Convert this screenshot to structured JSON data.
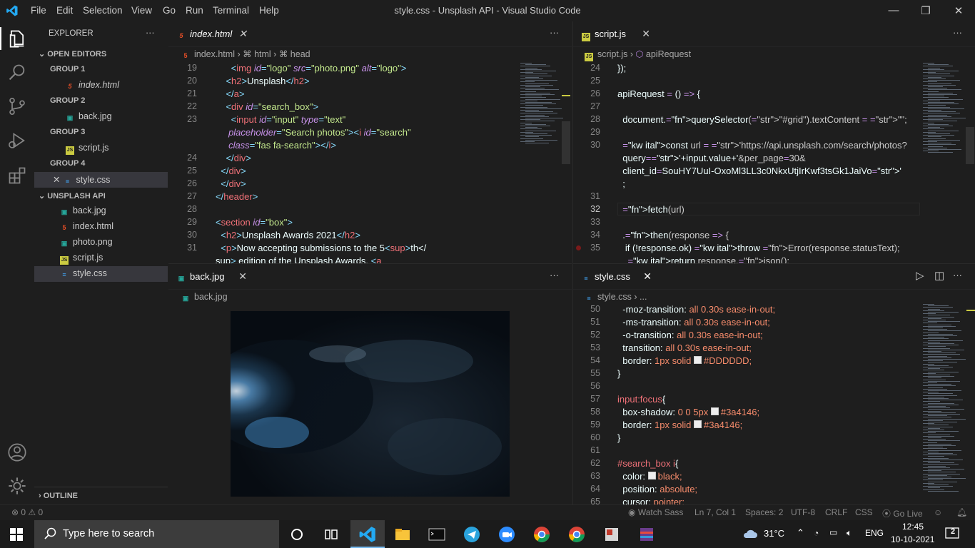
{
  "window": {
    "title": "style.css - Unsplash API - Visual Studio Code",
    "menu": [
      "File",
      "Edit",
      "Selection",
      "View",
      "Go",
      "Run",
      "Terminal",
      "Help"
    ],
    "controls": {
      "minimize": "—",
      "maximize": "❐",
      "close": "✕"
    }
  },
  "sidebar": {
    "title": "EXPLORER",
    "more": "···",
    "open_editors": "OPEN EDITORS",
    "groups": [
      {
        "label": "GROUP 1",
        "file": "index.html"
      },
      {
        "label": "GROUP 2",
        "file": "back.jpg"
      },
      {
        "label": "GROUP 3",
        "file": "script.js"
      },
      {
        "label": "GROUP 4",
        "file": "style.css"
      }
    ],
    "folder": "UNSPLASH API",
    "files": [
      "back.jpg",
      "index.html",
      "photo.png",
      "script.js",
      "style.css"
    ],
    "outline": "OUTLINE"
  },
  "panes": {
    "html": {
      "tab": "index.html",
      "crumbs": [
        "index.html",
        "html",
        "head"
      ],
      "lines": [
        [
          "19",
          "      <img id=\"logo\" src=\"photo.png\" alt=\"logo\">"
        ],
        [
          "20",
          "    <h2>Unsplash</h2>"
        ],
        [
          "21",
          "    </a>"
        ],
        [
          "22",
          "    <div id=\"search_box\">"
        ],
        [
          "23",
          "      <input id=\"input\" type=\"text\""
        ],
        [
          "",
          "     placeholder=\"Search photos\"><i id=\"search\""
        ],
        [
          "",
          "     class=\"fas fa-search\"></i>"
        ],
        [
          "24",
          "    </div>"
        ],
        [
          "25",
          "  </div>"
        ],
        [
          "26",
          "  </div>"
        ],
        [
          "27",
          "</header>"
        ],
        [
          "28",
          ""
        ],
        [
          "29",
          "<section id=\"box\">"
        ],
        [
          "30",
          "  <h2>Unsplash Awards 2021</h2>"
        ],
        [
          "31",
          "  <p>Now accepting submissions to the 5<sup>th</"
        ],
        [
          "",
          "sup> edition of the Unsplash Awards. <a"
        ]
      ]
    },
    "js": {
      "tab": "script.js",
      "crumbs": [
        "script.js",
        "apiRequest"
      ],
      "lines": [
        [
          "24",
          "});"
        ],
        [
          "25",
          ""
        ],
        [
          "26",
          "apiRequest = () => {"
        ],
        [
          "27",
          ""
        ],
        [
          "28",
          "  document.querySelector(\"#grid\").textContent = \"\";"
        ],
        [
          "29",
          ""
        ],
        [
          "30",
          "  const url = 'https://api.unsplash.com/search/photos?"
        ],
        [
          "",
          "  query='+input.value+'&per_page=30&"
        ],
        [
          "",
          "  client_id=SouHY7UuI-OxoMl3LL3c0NkxUtjIrKwf3tsGk1JaiVo'"
        ],
        [
          "",
          "  ;"
        ],
        [
          "31",
          ""
        ],
        [
          "32",
          "  fetch(url)"
        ],
        [
          "33",
          ""
        ],
        [
          "34",
          "  .then(response => {"
        ],
        [
          "35",
          "   if (!response.ok) throw Error(response.statusText);"
        ],
        [
          "",
          "    return response.json();"
        ]
      ]
    },
    "jpg": {
      "tab": "back.jpg",
      "crumb": "back.jpg"
    },
    "css": {
      "tab": "style.css",
      "crumbs": [
        "style.css",
        "..."
      ],
      "lines": [
        [
          "50",
          "  -moz-transition: all 0.30s ease-in-out;"
        ],
        [
          "51",
          "  -ms-transition: all 0.30s ease-in-out;"
        ],
        [
          "52",
          "  -o-transition: all 0.30s ease-in-out;"
        ],
        [
          "53",
          "  transition: all 0.30s ease-in-out;"
        ],
        [
          "54",
          "  border: 1px solid ■#DDDDDD;"
        ],
        [
          "55",
          "}"
        ],
        [
          "56",
          ""
        ],
        [
          "57",
          "input:focus{"
        ],
        [
          "58",
          "  box-shadow: 0 0 5px ■#3a4146;"
        ],
        [
          "59",
          "  border: 1px solid ■#3a4146;"
        ],
        [
          "60",
          "}"
        ],
        [
          "61",
          ""
        ],
        [
          "62",
          "#search_box i{"
        ],
        [
          "63",
          "  color: ■black;"
        ],
        [
          "64",
          "  position: absolute;"
        ],
        [
          "65",
          "  cursor: pointer;"
        ]
      ]
    }
  },
  "status": {
    "problems": "⊗ 0 ⚠ 0",
    "watch": "Watch Sass",
    "position": "Ln 7, Col 1",
    "spaces": "Spaces: 2",
    "encoding": "UTF-8",
    "eol": "CRLF",
    "lang": "CSS",
    "golive": "Go Live"
  },
  "taskbar": {
    "search_placeholder": "Type here to search",
    "weather": "31°C",
    "lang": "ENG",
    "time": "12:45",
    "date": "10-10-2021",
    "notif_count": "2"
  },
  "colors": {
    "accent": "#007acc",
    "tag": "#f07178",
    "string": "#c3e88d",
    "keyword": "#c792ea",
    "function": "#82aaff"
  }
}
